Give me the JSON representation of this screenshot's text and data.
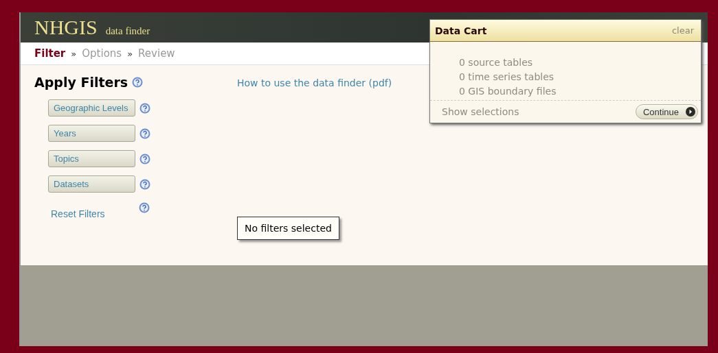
{
  "header": {
    "logo": "NHGIS",
    "subtitle": "data finder"
  },
  "steps": [
    {
      "label": "Filter",
      "selected": true
    },
    {
      "label": "Options",
      "selected": false
    },
    {
      "label": "Review",
      "selected": false
    }
  ],
  "step_separator": "»",
  "title": "Apply Filters",
  "help_link": "How to use the data finder (pdf)",
  "filters": [
    {
      "label": "Geographic Levels"
    },
    {
      "label": "Years"
    },
    {
      "label": "Topics"
    },
    {
      "label": "Datasets"
    }
  ],
  "reset_link": "Reset Filters",
  "status_message": "No filters selected",
  "data_cart": {
    "title": "Data Cart",
    "clear": "clear",
    "items": [
      "0 source tables",
      "0 time series tables",
      "0 GIS boundary files"
    ],
    "show_selections": "Show selections",
    "continue": "Continue"
  }
}
